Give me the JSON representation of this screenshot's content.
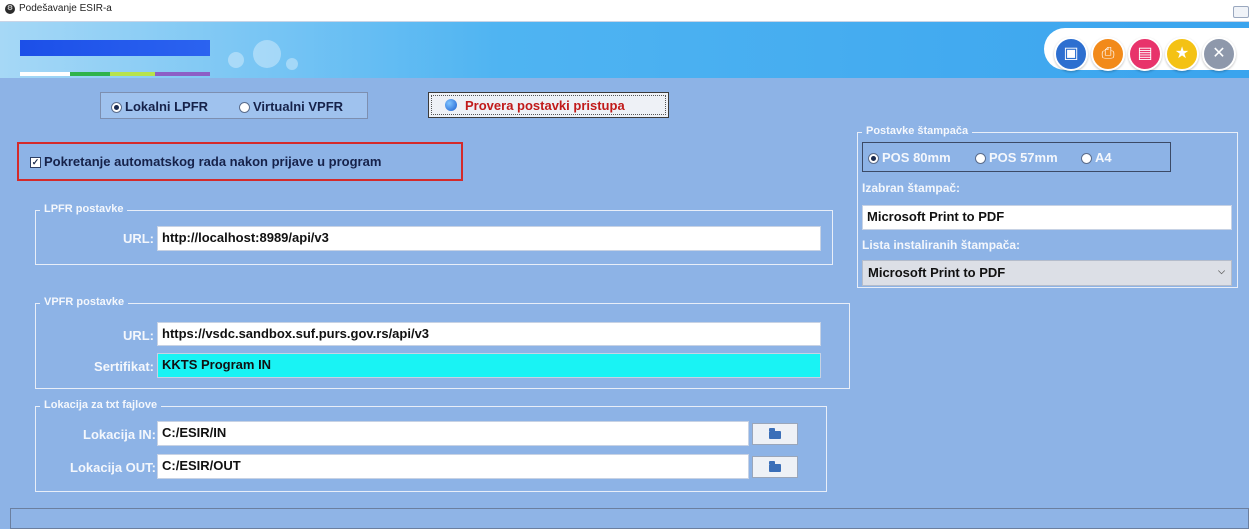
{
  "window": {
    "title": "Podešavanje ESIR-a"
  },
  "toolbar": {
    "buttons": [
      {
        "icon": "save-icon",
        "color": "#2d6fd0"
      },
      {
        "icon": "print-icon",
        "color": "#f28a1a"
      },
      {
        "icon": "delete-icon",
        "color": "#e8336b"
      },
      {
        "icon": "star-icon",
        "color": "#f4c214"
      },
      {
        "icon": "close-icon",
        "color": "#8e98ab"
      }
    ]
  },
  "mode": {
    "options": [
      {
        "label": "Lokalni LPFR",
        "selected": true
      },
      {
        "label": "Virtualni VPFR",
        "selected": false
      }
    ],
    "check_button": "Provera postavki pristupa"
  },
  "autostart": {
    "label": "Pokretanje automatskog rada nakon prijave u program",
    "checked": true
  },
  "lpfr": {
    "title": "LPFR postavke",
    "url_label": "URL:",
    "url_value": "http://localhost:8989/api/v3"
  },
  "vpfr": {
    "title": "VPFR postavke",
    "url_label": "URL:",
    "url_value": "https://vsdc.sandbox.suf.purs.gov.rs/api/v3",
    "cert_label": "Sertifikat:",
    "cert_value": "KKTS Program IN"
  },
  "txt": {
    "title": "Lokacija za txt fajlove",
    "in_label": "Lokacija IN:",
    "in_value": "C:/ESIR/IN",
    "out_label": "Lokacija OUT:",
    "out_value": "C:/ESIR/OUT"
  },
  "printer": {
    "title": "Postavke štampača",
    "formats": [
      {
        "label": "POS 80mm",
        "selected": true
      },
      {
        "label": "POS 57mm",
        "selected": false
      },
      {
        "label": "A4",
        "selected": false
      }
    ],
    "selected_label": "Izabran štampač:",
    "selected_value": "Microsoft Print to PDF",
    "list_label": "Lista instaliranih štampača:",
    "list_value": "Microsoft Print to PDF"
  },
  "colors": {
    "background": "#8db3e6",
    "highlight_border": "#d42a2a",
    "cert_field": "#19f3f4",
    "check_button_text": "#c11a1a"
  }
}
